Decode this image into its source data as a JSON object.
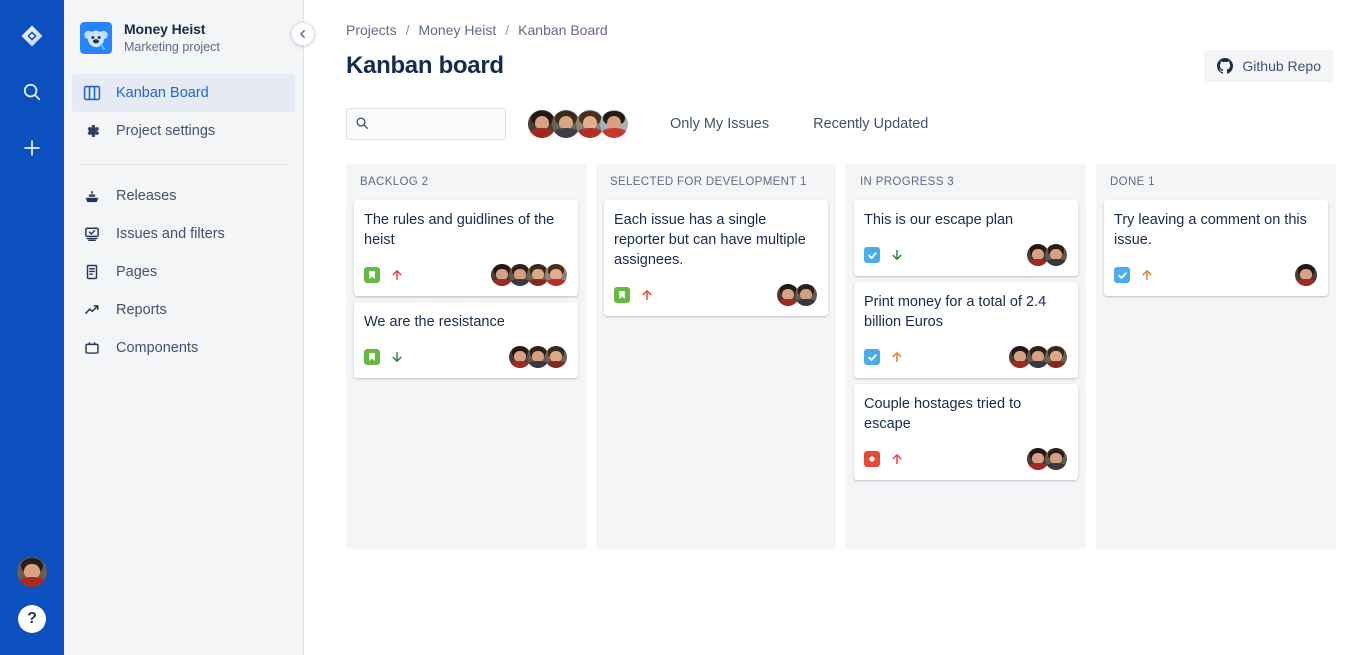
{
  "rail": {
    "logo_icon": "jira-diamond-logo",
    "items": [
      {
        "name": "search-icon",
        "label": "Search"
      },
      {
        "name": "create-icon",
        "label": "Create"
      }
    ],
    "profile_label": "Your profile and settings",
    "help_label": "?"
  },
  "sidebar": {
    "project": {
      "name": "Money Heist",
      "type": "Marketing project",
      "logo_icon": "koala-project-avatar"
    },
    "collapse_label": "Collapse sidebar",
    "primary_items": [
      {
        "label": "Kanban Board",
        "icon": "board-columns-icon",
        "active": true
      },
      {
        "label": "Project settings",
        "icon": "gear-icon",
        "active": false
      }
    ],
    "secondary_items": [
      {
        "label": "Releases",
        "icon": "releases-ship-icon"
      },
      {
        "label": "Issues and filters",
        "icon": "issues-monitor-icon"
      },
      {
        "label": "Pages",
        "icon": "pages-document-icon"
      },
      {
        "label": "Reports",
        "icon": "reports-chart-icon"
      },
      {
        "label": "Components",
        "icon": "components-box-icon"
      }
    ]
  },
  "header": {
    "breadcrumbs": [
      "Projects",
      "Money Heist",
      "Kanban Board"
    ],
    "breadcrumb_separator": "/",
    "title": "Kanban board",
    "github_button": {
      "label": "Github Repo",
      "icon": "github-icon"
    }
  },
  "filters": {
    "search": {
      "value": "",
      "placeholder": "",
      "icon": "search-icon"
    },
    "avatar_count": 4,
    "only_my_issues": "Only My Issues",
    "recently_updated": "Recently Updated"
  },
  "colors": {
    "rail_bg": "#0C4FBE",
    "sidebar_bg": "#F4F5F7",
    "column_bg": "#F4F5F7",
    "accent_link": "#1C65D9",
    "text_primary": "#172B4D",
    "text_subtle": "#5E6C84",
    "story_green": "#65BA43",
    "task_blue": "#4BADE8",
    "bug_red": "#E5493A",
    "priority_highest": "#E5493A",
    "priority_medium": "#E97F33",
    "priority_low": "#2D8738"
  },
  "board": {
    "columns": [
      {
        "name": "BACKLOG",
        "count": "2",
        "header": "BACKLOG 2",
        "cards": [
          {
            "title": "The rules and guidlines of the heist",
            "type": "story",
            "priority": "high",
            "priority_direction": "up",
            "avatars": 4
          },
          {
            "title": "We are the resistance",
            "type": "story",
            "priority": "low",
            "priority_direction": "down",
            "avatars": 3
          }
        ]
      },
      {
        "name": "SELECTED FOR DEVELOPMENT",
        "count": "1",
        "header": "SELECTED FOR DEVELOPMENT 1",
        "cards": [
          {
            "title": "Each issue has a single reporter but can have multiple assignees.",
            "type": "story",
            "priority": "high",
            "priority_direction": "up",
            "avatars": 2
          }
        ]
      },
      {
        "name": "IN PROGRESS",
        "count": "3",
        "header": "IN PROGRESS 3",
        "cards": [
          {
            "title": "This is our escape plan",
            "type": "task",
            "priority": "low",
            "priority_direction": "down",
            "avatars": 2
          },
          {
            "title": "Print money for a total of 2.4 billion Euros",
            "type": "task",
            "priority": "medium",
            "priority_direction": "up",
            "avatars": 3
          },
          {
            "title": "Couple hostages tried to escape",
            "type": "bug",
            "priority": "high",
            "priority_direction": "up",
            "avatars": 2
          }
        ]
      },
      {
        "name": "DONE",
        "count": "1",
        "header": "DONE 1",
        "cards": [
          {
            "title": "Try leaving a comment on this issue.",
            "type": "task",
            "priority": "medium",
            "priority_direction": "up",
            "avatars": 1
          }
        ]
      }
    ]
  }
}
